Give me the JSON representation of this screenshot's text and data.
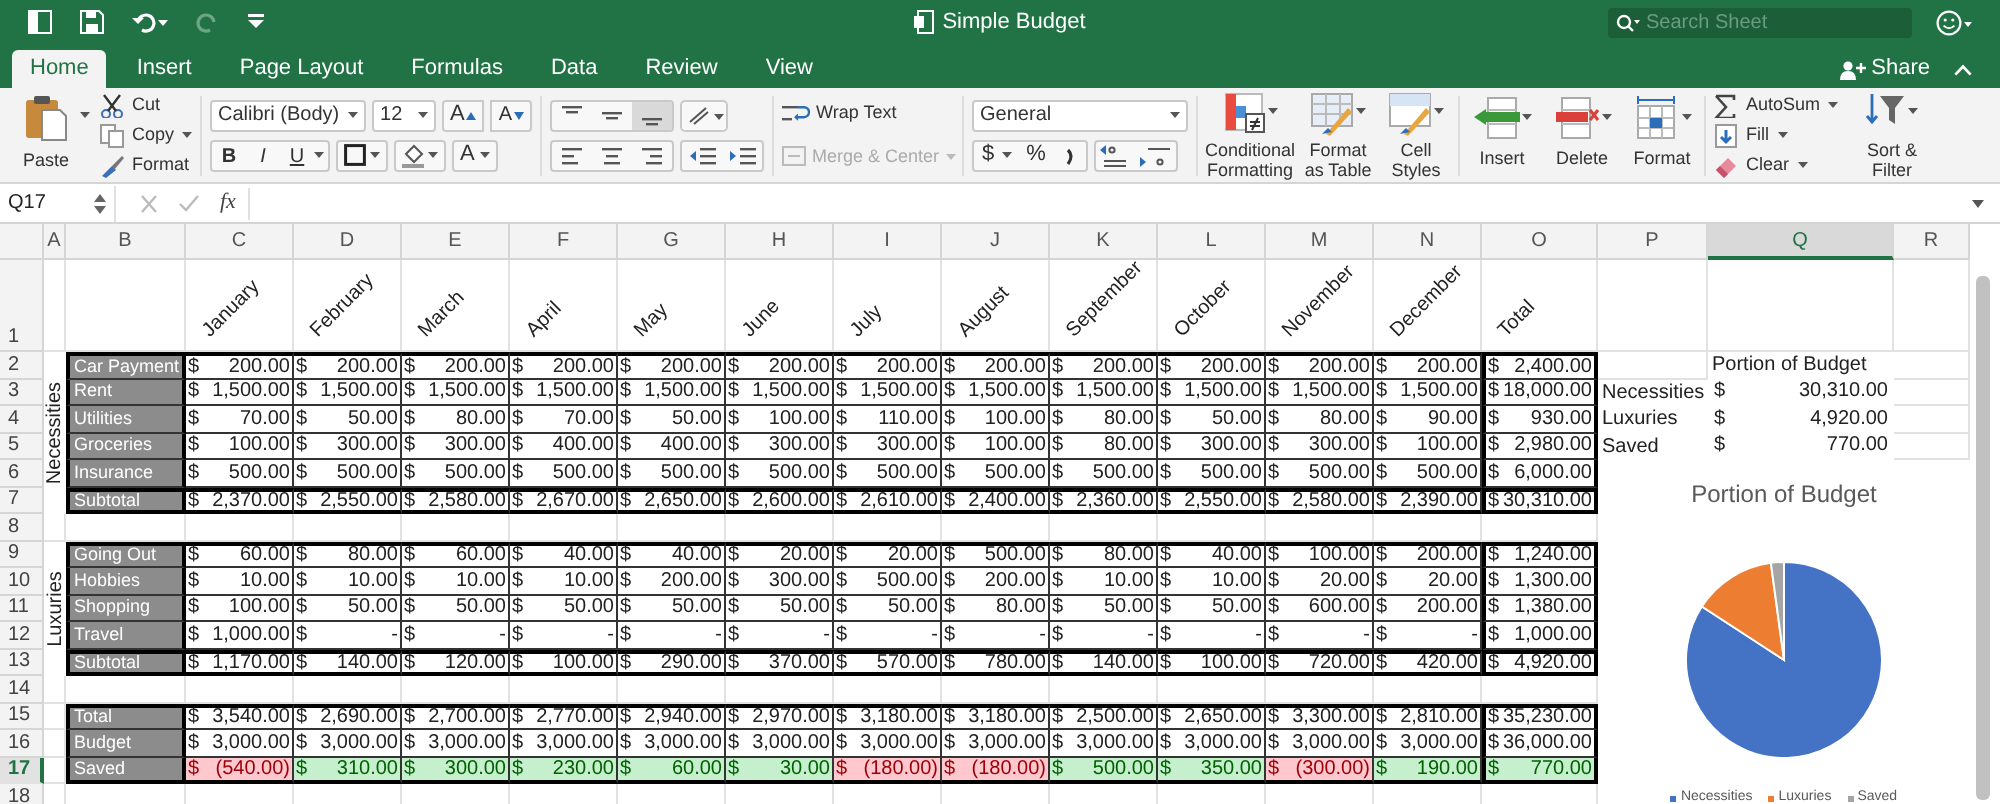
{
  "title_bar": {
    "title": "Simple Budget",
    "search": {
      "placeholder": "Search Sheet"
    }
  },
  "tabs": [
    {
      "label": "Home",
      "selected": true
    },
    {
      "label": "Insert",
      "selected": false
    },
    {
      "label": "Page Layout",
      "selected": false
    },
    {
      "label": "Formulas",
      "selected": false
    },
    {
      "label": "Data",
      "selected": false
    },
    {
      "label": "Review",
      "selected": false
    },
    {
      "label": "View",
      "selected": false
    }
  ],
  "share": {
    "label": "Share"
  },
  "ribbon": {
    "clipboard": {
      "paste": "Paste",
      "items": [
        "Cut",
        "Copy",
        "Format"
      ]
    },
    "font": {
      "name": "Calibri (Body)",
      "size": "12",
      "grow": "A",
      "shrink": "A",
      "styles": [
        "B",
        "I",
        "U"
      ],
      "font_color": "A"
    },
    "alignment": {
      "wrap_text": {
        "label": "Wrap Text",
        "disabled": false
      },
      "merge_center": {
        "label": "Merge & Center",
        "disabled": true
      }
    },
    "number": {
      "format": "General",
      "symbols": [
        "$",
        "%"
      ]
    },
    "styles": [
      "Conditional Formatting",
      "Format as Table",
      "Cell Styles"
    ],
    "cells": [
      "Insert",
      "Delete",
      "Format"
    ],
    "editing": {
      "items": [
        "AutoSum",
        "Fill",
        "Clear"
      ],
      "sort_filter": "Sort & Filter"
    }
  },
  "formula_bar": {
    "name_box": "Q17",
    "function_label": "fx"
  },
  "columns": [
    {
      "label": "A",
      "selected": false
    },
    {
      "label": "B",
      "selected": false
    },
    {
      "label": "C",
      "selected": false
    },
    {
      "label": "D",
      "selected": false
    },
    {
      "label": "E",
      "selected": false
    },
    {
      "label": "F",
      "selected": false
    },
    {
      "label": "G",
      "selected": false
    },
    {
      "label": "H",
      "selected": false
    },
    {
      "label": "I",
      "selected": false
    },
    {
      "label": "J",
      "selected": false
    },
    {
      "label": "K",
      "selected": false
    },
    {
      "label": "L",
      "selected": false
    },
    {
      "label": "M",
      "selected": false
    },
    {
      "label": "N",
      "selected": false
    },
    {
      "label": "O",
      "selected": false
    },
    {
      "label": "P",
      "selected": false
    },
    {
      "label": "Q",
      "selected": true
    },
    {
      "label": "R",
      "selected": false
    }
  ],
  "row_numbers": [
    {
      "label": "1",
      "selected": false
    },
    {
      "label": "2",
      "selected": false
    },
    {
      "label": "3",
      "selected": false
    },
    {
      "label": "4",
      "selected": false
    },
    {
      "label": "5",
      "selected": false
    },
    {
      "label": "6",
      "selected": false
    },
    {
      "label": "7",
      "selected": false
    },
    {
      "label": "8",
      "selected": false
    },
    {
      "label": "9",
      "selected": false
    },
    {
      "label": "10",
      "selected": false
    },
    {
      "label": "11",
      "selected": false
    },
    {
      "label": "12",
      "selected": false
    },
    {
      "label": "13",
      "selected": false
    },
    {
      "label": "14",
      "selected": false
    },
    {
      "label": "15",
      "selected": false
    },
    {
      "label": "16",
      "selected": false
    },
    {
      "label": "17",
      "selected": true
    },
    {
      "label": "18",
      "selected": false
    }
  ],
  "sheet": {
    "headers": [
      "January",
      "February",
      "March",
      "April",
      "May",
      "June",
      "July",
      "August",
      "September",
      "October",
      "November",
      "December",
      "Total"
    ],
    "sections": [
      {
        "side_label": "Necessities",
        "rows": [
          {
            "label": "Car Payment",
            "cells": [
              "$ 200.00",
              "$ 200.00",
              "$ 200.00",
              "$ 200.00",
              "$ 200.00",
              "$ 200.00",
              "$ 200.00",
              "$ 200.00",
              "$ 200.00",
              "$ 200.00",
              "$ 200.00",
              "$ 200.00",
              "$ 2,400.00"
            ]
          },
          {
            "label": "Rent",
            "cells": [
              "$ 1,500.00",
              "$ 1,500.00",
              "$ 1,500.00",
              "$ 1,500.00",
              "$ 1,500.00",
              "$ 1,500.00",
              "$ 1,500.00",
              "$ 1,500.00",
              "$ 1,500.00",
              "$ 1,500.00",
              "$ 1,500.00",
              "$ 1,500.00",
              "$ 18,000.00"
            ]
          },
          {
            "label": "Utilities",
            "cells": [
              "$ 70.00",
              "$ 50.00",
              "$ 80.00",
              "$ 70.00",
              "$ 50.00",
              "$ 100.00",
              "$ 110.00",
              "$ 100.00",
              "$ 80.00",
              "$ 50.00",
              "$ 80.00",
              "$ 90.00",
              "$ 930.00"
            ]
          },
          {
            "label": "Groceries",
            "cells": [
              "$ 100.00",
              "$ 300.00",
              "$ 300.00",
              "$ 400.00",
              "$ 400.00",
              "$ 300.00",
              "$ 300.00",
              "$ 100.00",
              "$ 80.00",
              "$ 300.00",
              "$ 300.00",
              "$ 100.00",
              "$ 2,980.00"
            ]
          },
          {
            "label": "Insurance",
            "cells": [
              "$ 500.00",
              "$ 500.00",
              "$ 500.00",
              "$ 500.00",
              "$ 500.00",
              "$ 500.00",
              "$ 500.00",
              "$ 500.00",
              "$ 500.00",
              "$ 500.00",
              "$ 500.00",
              "$ 500.00",
              "$ 6,000.00"
            ]
          },
          {
            "label": "Subtotal",
            "cells": [
              "$ 2,370.00",
              "$ 2,550.00",
              "$ 2,580.00",
              "$ 2,670.00",
              "$ 2,650.00",
              "$ 2,600.00",
              "$ 2,610.00",
              "$ 2,400.00",
              "$ 2,360.00",
              "$ 2,550.00",
              "$ 2,580.00",
              "$ 2,390.00",
              "$ 30,310.00"
            ]
          }
        ]
      },
      {
        "side_label": "Luxuries",
        "rows": [
          {
            "label": "Going Out",
            "cells": [
              "$ 60.00",
              "$ 80.00",
              "$ 60.00",
              "$ 40.00",
              "$ 40.00",
              "$ 20.00",
              "$ 20.00",
              "$ 500.00",
              "$ 80.00",
              "$ 40.00",
              "$ 100.00",
              "$ 200.00",
              "$ 1,240.00"
            ]
          },
          {
            "label": "Hobbies",
            "cells": [
              "$ 10.00",
              "$ 10.00",
              "$ 10.00",
              "$ 10.00",
              "$ 200.00",
              "$ 300.00",
              "$ 500.00",
              "$ 200.00",
              "$ 10.00",
              "$ 10.00",
              "$ 20.00",
              "$ 20.00",
              "$ 1,300.00"
            ]
          },
          {
            "label": "Shopping",
            "cells": [
              "$ 100.00",
              "$ 50.00",
              "$ 50.00",
              "$ 50.00",
              "$ 50.00",
              "$ 50.00",
              "$ 50.00",
              "$ 80.00",
              "$ 50.00",
              "$ 50.00",
              "$ 600.00",
              "$ 200.00",
              "$ 1,380.00"
            ]
          },
          {
            "label": "Travel",
            "cells": [
              "$ 1,000.00",
              "$ -",
              "$ -",
              "$ -",
              "$ -",
              "$ -",
              "$ -",
              "$ -",
              "$ -",
              "$ -",
              "$ -",
              "$ -",
              "$ 1,000.00"
            ]
          },
          {
            "label": "Subtotal",
            "cells": [
              "$ 1,170.00",
              "$ 140.00",
              "$ 120.00",
              "$ 100.00",
              "$ 290.00",
              "$ 370.00",
              "$ 570.00",
              "$ 780.00",
              "$ 140.00",
              "$ 100.00",
              "$ 720.00",
              "$ 420.00",
              "$ 4,920.00"
            ]
          }
        ]
      },
      {
        "rows": [
          {
            "label": "Total",
            "cells": [
              "$ 3,540.00",
              "$ 2,690.00",
              "$ 2,700.00",
              "$ 2,770.00",
              "$ 2,940.00",
              "$ 2,970.00",
              "$ 3,180.00",
              "$ 3,180.00",
              "$ 2,500.00",
              "$ 2,650.00",
              "$ 3,300.00",
              "$ 2,810.00",
              "$ 35,230.00"
            ]
          },
          {
            "label": "Budget",
            "cells": [
              "$ 3,000.00",
              "$ 3,000.00",
              "$ 3,000.00",
              "$ 3,000.00",
              "$ 3,000.00",
              "$ 3,000.00",
              "$ 3,000.00",
              "$ 3,000.00",
              "$ 3,000.00",
              "$ 3,000.00",
              "$ 3,000.00",
              "$ 3,000.00",
              "$ 36,000.00"
            ]
          },
          {
            "label": "Saved",
            "cells": [
              "$ (540.00)",
              "$ 310.00",
              "$ 300.00",
              "$ 230.00",
              "$ 60.00",
              "$ 30.00",
              "$ (180.00)",
              "$ (180.00)",
              "$ 500.00",
              "$ 350.00",
              "$ (300.00)",
              "$ 190.00",
              "$ 770.00"
            ],
            "negative": [
              true,
              false,
              false,
              false,
              false,
              false,
              true,
              true,
              false,
              false,
              true,
              false,
              false
            ]
          }
        ]
      }
    ]
  },
  "summary": {
    "title": "Portion of Budget",
    "rows": [
      {
        "label": "Necessities",
        "amount": "$ 30,310.00"
      },
      {
        "label": "Luxuries",
        "amount": "$ 4,920.00"
      },
      {
        "label": "Saved",
        "amount": "$ 770.00"
      }
    ]
  },
  "chart": {
    "chart_data": {
      "type": "pie",
      "title": "Portion of Budget",
      "categories": [
        "Necessities",
        "Luxuries",
        "Saved"
      ],
      "legend": "bottom",
      "series": [
        {
          "values": [
            84.19,
            13.67,
            2.14
          ],
          "colors": [
            "#4472c4",
            "#ed7d31",
            "#a5a5a5"
          ]
        }
      ]
    }
  }
}
